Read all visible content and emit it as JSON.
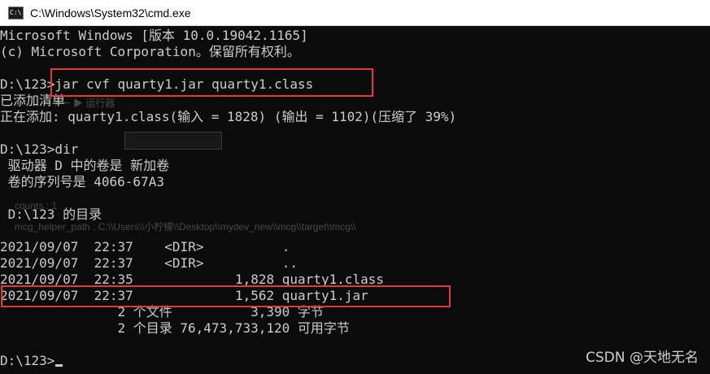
{
  "window": {
    "title": "C:\\Windows\\System32\\cmd.exe",
    "icon": "cmd-app-icon",
    "icon_glyph": "C:\\"
  },
  "console": {
    "lines": [
      "Microsoft Windows [版本 10.0.19042.1165]",
      "(c) Microsoft Corporation。保留所有权利。",
      "",
      "D:\\123>jar cvf quarty1.jar quarty1.class",
      "已添加清单",
      "正在添加: quarty1.class(输入 = 1828) (输出 = 1102)(压缩了 39%)",
      "",
      "D:\\123>dir",
      " 驱动器 D 中的卷是 新加卷",
      " 卷的序列号是 4066-67A3",
      "",
      " D:\\123 的目录",
      "",
      "2021/09/07  22:37    <DIR>          .",
      "2021/09/07  22:37    <DIR>          ..",
      "2021/09/07  22:35             1,828 quarty1.class",
      "2021/09/07  22:37             1,562 quarty1.jar",
      "               2 个文件          3,390 字节",
      "               2 个目录 76,473,733,120 可用字节",
      "",
      "D:\\123>"
    ]
  },
  "background_ghost": {
    "toolbar_text": "/ 一 ▶ 运行器",
    "counts": "counts : 1",
    "helper_path": "mcg_helper_path : C:\\\\Users\\\\小柠檬\\\\Desktop\\\\mydev_new\\\\mcg\\\\target\\\\mcg\\\\"
  },
  "watermark": "CSDN @天地无名",
  "colors": {
    "console_bg": "#0c0c0c",
    "console_text": "#cccccc",
    "annotation_red": "#e53935"
  }
}
